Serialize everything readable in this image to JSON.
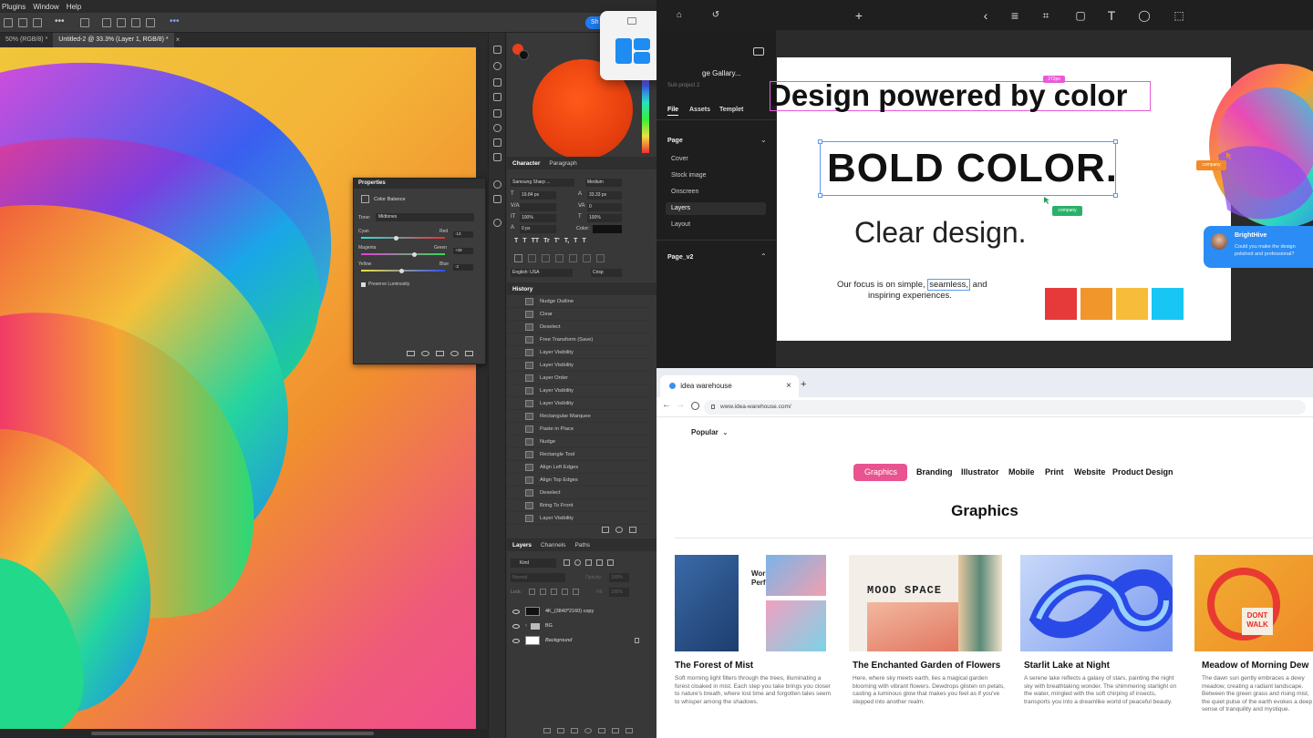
{
  "photoshop": {
    "menu": [
      "Plugins",
      "Window",
      "Help"
    ],
    "tabs": [
      "50% (RGB/8) *",
      "Untitled-2 @ 33.3% (Layer 1, RGB/8) *"
    ],
    "share_label": "Sh",
    "properties": {
      "title": "Properties",
      "subtitle": "Color Balance",
      "tone_label": "Tone:",
      "tone_value": "Midtones",
      "sliders": [
        {
          "left": "Cyan",
          "right": "Red",
          "value": "-13"
        },
        {
          "left": "Magenta",
          "right": "Green",
          "value": "+28"
        },
        {
          "left": "Yellow",
          "right": "Blue",
          "value": "-2"
        }
      ],
      "preserve_label": "Preserve Luminosity"
    },
    "character": {
      "tabs": [
        "Character",
        "Paragraph"
      ],
      "font": "Samsung Sharp ...",
      "weight": "Medium",
      "size": "19.84 px",
      "leading": "33.33 px",
      "tracking": "0",
      "scale_v": "100%",
      "scale_h": "100%",
      "baseline": "0 px",
      "color_label": "Color:",
      "language": "English: USA",
      "aa": "Crisp",
      "style_buttons": [
        "T",
        "T",
        "TT",
        "Tr",
        "T'",
        "T,",
        "T",
        "T"
      ]
    },
    "history": {
      "title": "History",
      "items": [
        "Nudge Outline",
        "Clear",
        "Deselect",
        "Free Transform (Save)",
        "Layer Visibility",
        "Layer Visibility",
        "Layer Order",
        "Layer Visibility",
        "Layer Visibility",
        "Rectangular Marquee",
        "Paste in Place",
        "Nudge",
        "Rectangle Tool",
        "Align Left Edges",
        "Align Top Edges",
        "Deselect",
        "Bring To Front",
        "Layer Visibility"
      ]
    },
    "layers": {
      "tabs": [
        "Layers",
        "Channels",
        "Paths"
      ],
      "kind": "Kind",
      "blend": "Normal",
      "opacity_label": "Opacity:",
      "opacity": "100%",
      "lock_label": "Lock:",
      "fill_label": "Fill:",
      "fill": "100%",
      "items": [
        "4K_(3840*2160) copy",
        "BG",
        "Background"
      ]
    }
  },
  "design_tool": {
    "project_title": "ge Gallary...",
    "sub_project": "Sub project 2",
    "tabs": [
      "File",
      "Assets",
      "Templet"
    ],
    "page_section": "Page",
    "page_items": [
      "Cover",
      "Stock image",
      "Onscreen",
      "Layers",
      "Layout"
    ],
    "page2_section": "Page_v2",
    "measure_tag": "272px",
    "headline": "Design powered by color",
    "bold_text": "BOLD COLOR.",
    "clear_text": "Clear design.",
    "company_tag": "company",
    "company_tag2": "company",
    "body_pre": "Our focus is on simple,",
    "body_highlight": "seamless,",
    "body_post": "and",
    "body_line2": "inspiring experiences.",
    "swatches": [
      "#e63a3a",
      "#f0962a",
      "#f7bd3a",
      "#18c6f4"
    ],
    "chat": {
      "name": "BrightHive",
      "message_line1": "Could you make the design",
      "message_line2": "polished and professional?"
    }
  },
  "browser": {
    "tab_title": "idea warehouse",
    "url": "www.idea-warehouse.com/",
    "dropdown": "Popular",
    "categories": [
      "Graphics",
      "Branding",
      "Illustrator",
      "Mobile",
      "Print",
      "Website",
      "Product Design"
    ],
    "section_title": "Graphics",
    "cards": [
      {
        "title": "The Forest of Mist",
        "desc": "Soft morning light filters through the trees, illuminating a forest cloaked in mist. Each step you take brings you closer to nature's breath, where lost time and forgotten tales seem to whisper among the shadows.",
        "img_text": "Work Performance"
      },
      {
        "title": "The Enchanted Garden of Flowers",
        "desc": "Here, where sky meets earth, lies a magical garden blooming with vibrant flowers. Dewdrops glisten on petals, casting a luminous glow that makes you feel as if you've stepped into another realm.",
        "img_text": "MOOD SPACE"
      },
      {
        "title": "Starlit Lake at Night",
        "desc": "A serene lake reflects a galaxy of stars, painting the night sky with breathtaking wonder. The shimmering starlight on the water, mingled with the soft chirping of insects, transports you into a dreamlike world of peaceful beauty.",
        "img_text": ""
      },
      {
        "title": "Meadow of Morning Dew",
        "desc": "The dawn sun gently embraces a dewy meadow, creating a radiant landscape. Between the green grass and rising mist, the quiet pulse of the earth evokes a deep sense of tranquility and mystique.",
        "img_text": "DONT WALK"
      }
    ]
  }
}
